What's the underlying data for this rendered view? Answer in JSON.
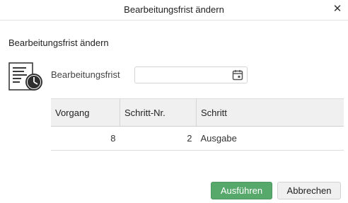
{
  "dialog": {
    "title": "Bearbeitungsfrist ändern",
    "close_label": "✕"
  },
  "form": {
    "heading": "Bearbeitungsfrist ändern",
    "icon": "task-deadline-icon",
    "deadline_label": "Bearbeitungsfrist",
    "deadline_value": "",
    "calendar_icon": "calendar-icon"
  },
  "table": {
    "columns": [
      "Vorgang",
      "Schritt-Nr.",
      "Schritt"
    ],
    "rows": [
      {
        "vorgang": "8",
        "schritt_nr": "2",
        "schritt": "Ausgabe"
      }
    ]
  },
  "buttons": {
    "execute_label": "Ausführen",
    "cancel_label": "Abbrechen"
  },
  "colors": {
    "primary": "#57a86b",
    "header_bg": "#f0f0f0"
  }
}
